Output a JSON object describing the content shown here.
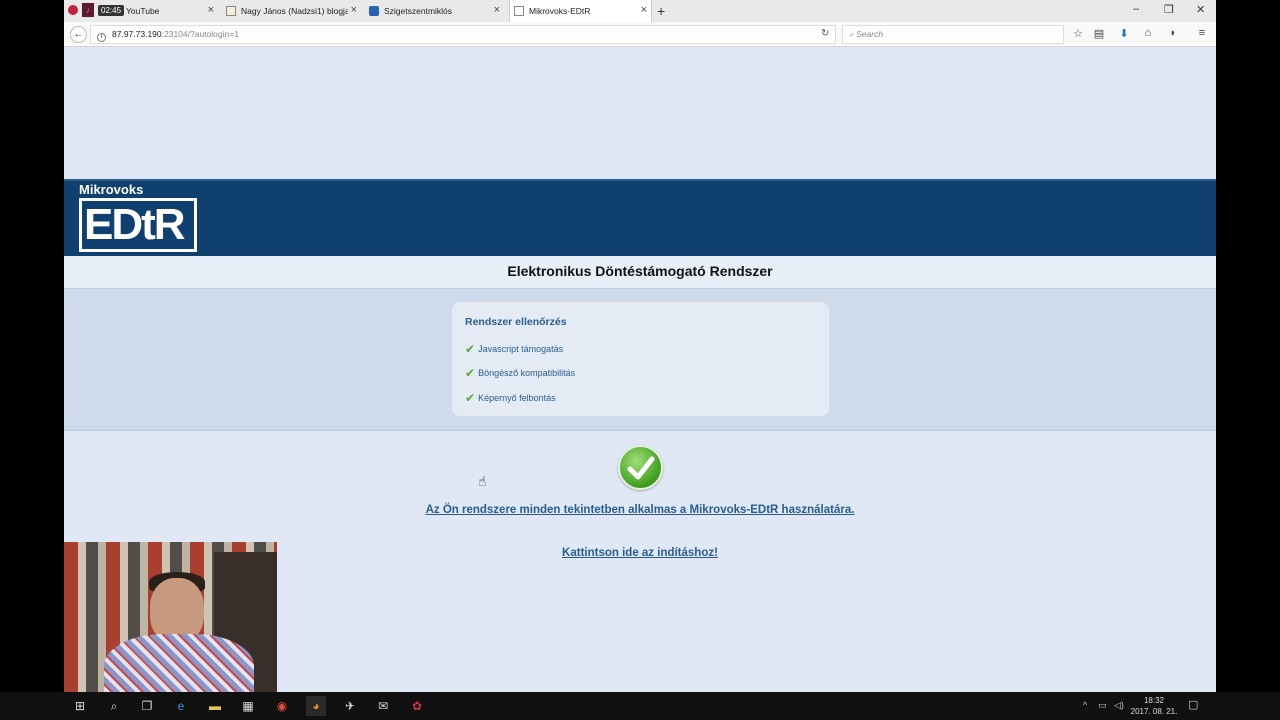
{
  "recorder": {
    "time": "02:45"
  },
  "tabs": [
    {
      "label": "YouTube"
    },
    {
      "label": "Nagy János (Nadzsi1) blogja"
    },
    {
      "label": "Szigetszentmiklós"
    },
    {
      "label": "Mikrovoks-EDtR"
    }
  ],
  "navbar": {
    "url_host": "87.97.73.190",
    "url_rest": ":23104/?autologin=1",
    "search_placeholder": "Search"
  },
  "page": {
    "logo_top": "Mikrovoks",
    "logo_main": "EDtR",
    "title": "Elektronikus Döntéstámogató Rendszer",
    "check_panel_title": "Rendszer ellenőrzés",
    "checks": [
      {
        "label": "Javascript támogatás"
      },
      {
        "label": "Böngésző kompatibilitás"
      },
      {
        "label": "Képernyő felbontás"
      }
    ],
    "result_link": "Az Ön rendszere minden tekintetben alkalmas a Mikrovoks-EDtR használatára.",
    "start_link": "Kattintson ide az indításhoz!"
  },
  "taskbar": {
    "clock_time": "18:32",
    "clock_date": "2017. 08. 21."
  },
  "colors": {
    "banner": "#104070",
    "link": "#2a5d8e",
    "check_green": "#5aa82d",
    "page_bg": "#dfe8f4"
  }
}
